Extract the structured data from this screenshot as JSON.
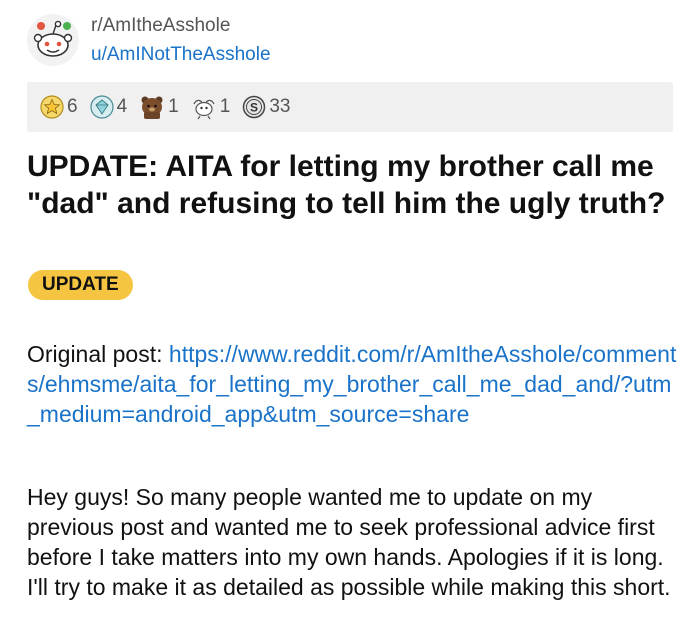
{
  "post": {
    "subreddit": "r/AmItheAsshole",
    "username": "u/AmINotTheAsshole",
    "awards": [
      {
        "icon": "gold-star-award-icon",
        "count": "6"
      },
      {
        "icon": "platinum-gem-award-icon",
        "count": "4"
      },
      {
        "icon": "bear-award-icon",
        "count": "1"
      },
      {
        "icon": "wholesome-award-icon",
        "count": "1"
      },
      {
        "icon": "silver-award-icon",
        "count": "33"
      }
    ],
    "title": "UPDATE: AITA for letting my brother call me \"dad\" and refusing to tell him the ugly truth?",
    "flair": "UPDATE",
    "original_label": "Original post: ",
    "original_link": "https://www.reddit.com/r/AmItheAsshole/comments/ehmsme/aita_for_letting_my_brother_call_me_dad_and/?utm_medium=android_app&utm_source=share",
    "body": "Hey guys! So many people wanted me to update on my previous post and wanted me to seek professional advice first before I take matters into my own hands. Apologies if it is long. I'll try to make it as detailed as possible while making this short."
  },
  "colors": {
    "link": "#1a73c8",
    "flair_bg": "#f5c542",
    "awards_bg": "#f0f0f0"
  }
}
